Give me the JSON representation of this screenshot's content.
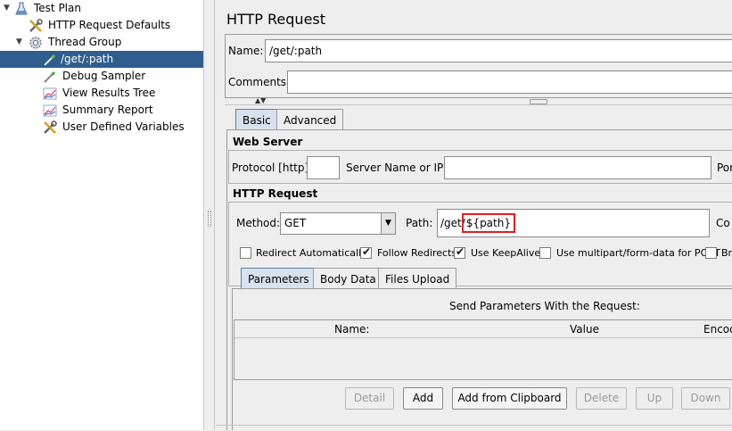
{
  "tree": {
    "items": [
      {
        "label": "Test Plan",
        "icon": "flask-icon"
      },
      {
        "label": "HTTP Request Defaults",
        "icon": "wrench-icon"
      },
      {
        "label": "Thread Group",
        "icon": "gear-icon"
      },
      {
        "label": "/get/:path",
        "icon": "pipette-icon"
      },
      {
        "label": "Debug Sampler",
        "icon": "pipette-icon"
      },
      {
        "label": "View Results Tree",
        "icon": "chart-icon"
      },
      {
        "label": "Summary Report",
        "icon": "chart-icon"
      },
      {
        "label": "User Defined Variables",
        "icon": "wrench-icon"
      }
    ]
  },
  "panel": {
    "title": "HTTP Request",
    "name_label": "Name:",
    "name_value": "/get/:path",
    "comments_label": "Comments:",
    "comments_value": "",
    "tabs": [
      "Basic",
      "Advanced"
    ],
    "active_tab": "Basic"
  },
  "web_server": {
    "heading": "Web Server",
    "protocol_label": "Protocol [http]:",
    "protocol_value": "",
    "server_label": "Server Name or IP:",
    "server_value": "",
    "port_label_cut": "Por"
  },
  "http_request": {
    "heading": "HTTP Request",
    "method_label": "Method:",
    "method_value": "GET",
    "path_label": "Path:",
    "path_prefix": "/get/",
    "path_var": "${path}",
    "content_label_cut": "Co",
    "highlight_color": "#e02020"
  },
  "options": [
    {
      "label": "Redirect Automatically",
      "checked": false
    },
    {
      "label": "Follow Redirects",
      "checked": true
    },
    {
      "label": "Use KeepAlive",
      "checked": true
    },
    {
      "label": "Use multipart/form-data for POST",
      "checked": false
    },
    {
      "label": "Br",
      "checked": false
    }
  ],
  "param_tabs": [
    "Parameters",
    "Body Data",
    "Files Upload"
  ],
  "params": {
    "caption": "Send Parameters With the Request:",
    "col_name": "Name:",
    "col_value": "Value",
    "col_encode_cut": "Encod"
  },
  "buttons": {
    "detail": "Detail",
    "add": "Add",
    "add_clip": "Add from Clipboard",
    "delete": "Delete",
    "up": "Up",
    "down": "Down"
  }
}
